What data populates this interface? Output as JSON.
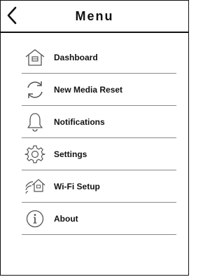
{
  "header": {
    "title": "Menu",
    "back_icon": "chevron-left-icon"
  },
  "menu": {
    "items": [
      {
        "label": "Dashboard",
        "icon": "home-icon"
      },
      {
        "label": "New Media Reset",
        "icon": "refresh-icon"
      },
      {
        "label": "Notifications",
        "icon": "bell-icon"
      },
      {
        "label": "Settings",
        "icon": "gear-icon"
      },
      {
        "label": "Wi-Fi Setup",
        "icon": "wifi-home-icon"
      },
      {
        "label": "About",
        "icon": "info-icon"
      }
    ]
  }
}
